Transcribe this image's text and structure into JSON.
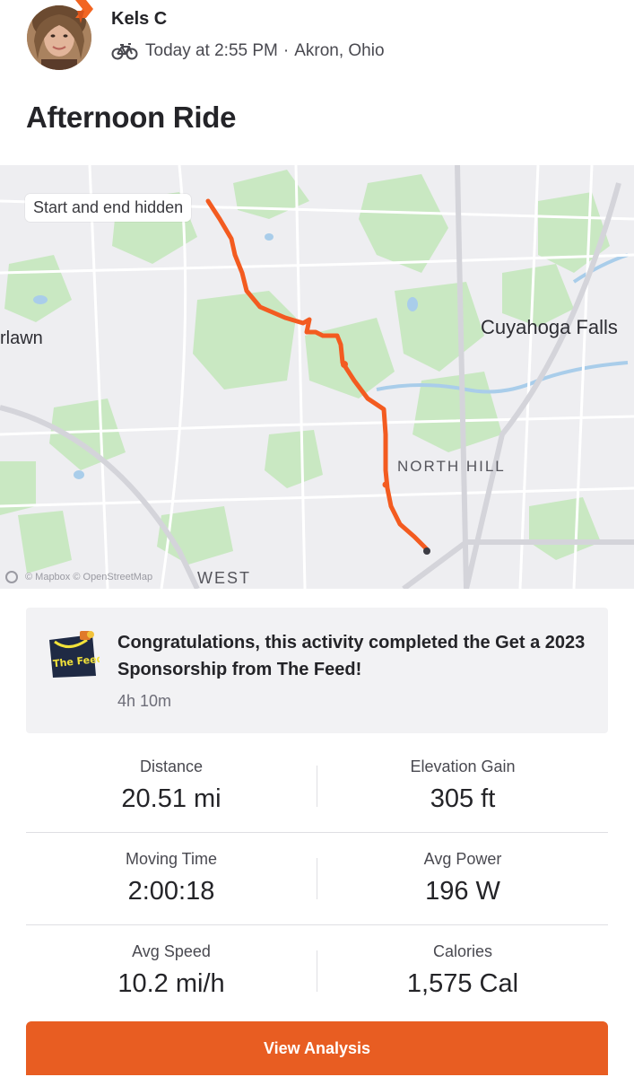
{
  "athlete": {
    "name": "Kels C"
  },
  "activity": {
    "when": "Today at 2:55 PM",
    "separator": "·",
    "location": "Akron, Ohio",
    "title": "Afternoon Ride",
    "sport_icon": "bike-icon"
  },
  "map": {
    "chip": "Start and end hidden",
    "labels": {
      "city": "Cuyahoga Falls",
      "lawn": "rlawn",
      "north_hill": "NORTH HILL",
      "west": "WEST"
    },
    "attribution": "© Mapbox © OpenStreetMap",
    "route_color": "#f35b20"
  },
  "achievement": {
    "logo_text": "The Feed.",
    "text": "Congratulations, this activity completed the Get a 2023 Sponsorship from The Feed!",
    "time": "4h 10m"
  },
  "stats": [
    [
      {
        "label": "Distance",
        "value": "20.51 mi"
      },
      {
        "label": "Elevation Gain",
        "value": "305 ft"
      }
    ],
    [
      {
        "label": "Moving Time",
        "value": "2:00:18"
      },
      {
        "label": "Avg Power",
        "value": "196 W"
      }
    ],
    [
      {
        "label": "Avg Speed",
        "value": "10.2 mi/h"
      },
      {
        "label": "Calories",
        "value": "1,575 Cal"
      }
    ]
  ],
  "cta": {
    "label": "View Analysis",
    "color": "#e85d22"
  }
}
